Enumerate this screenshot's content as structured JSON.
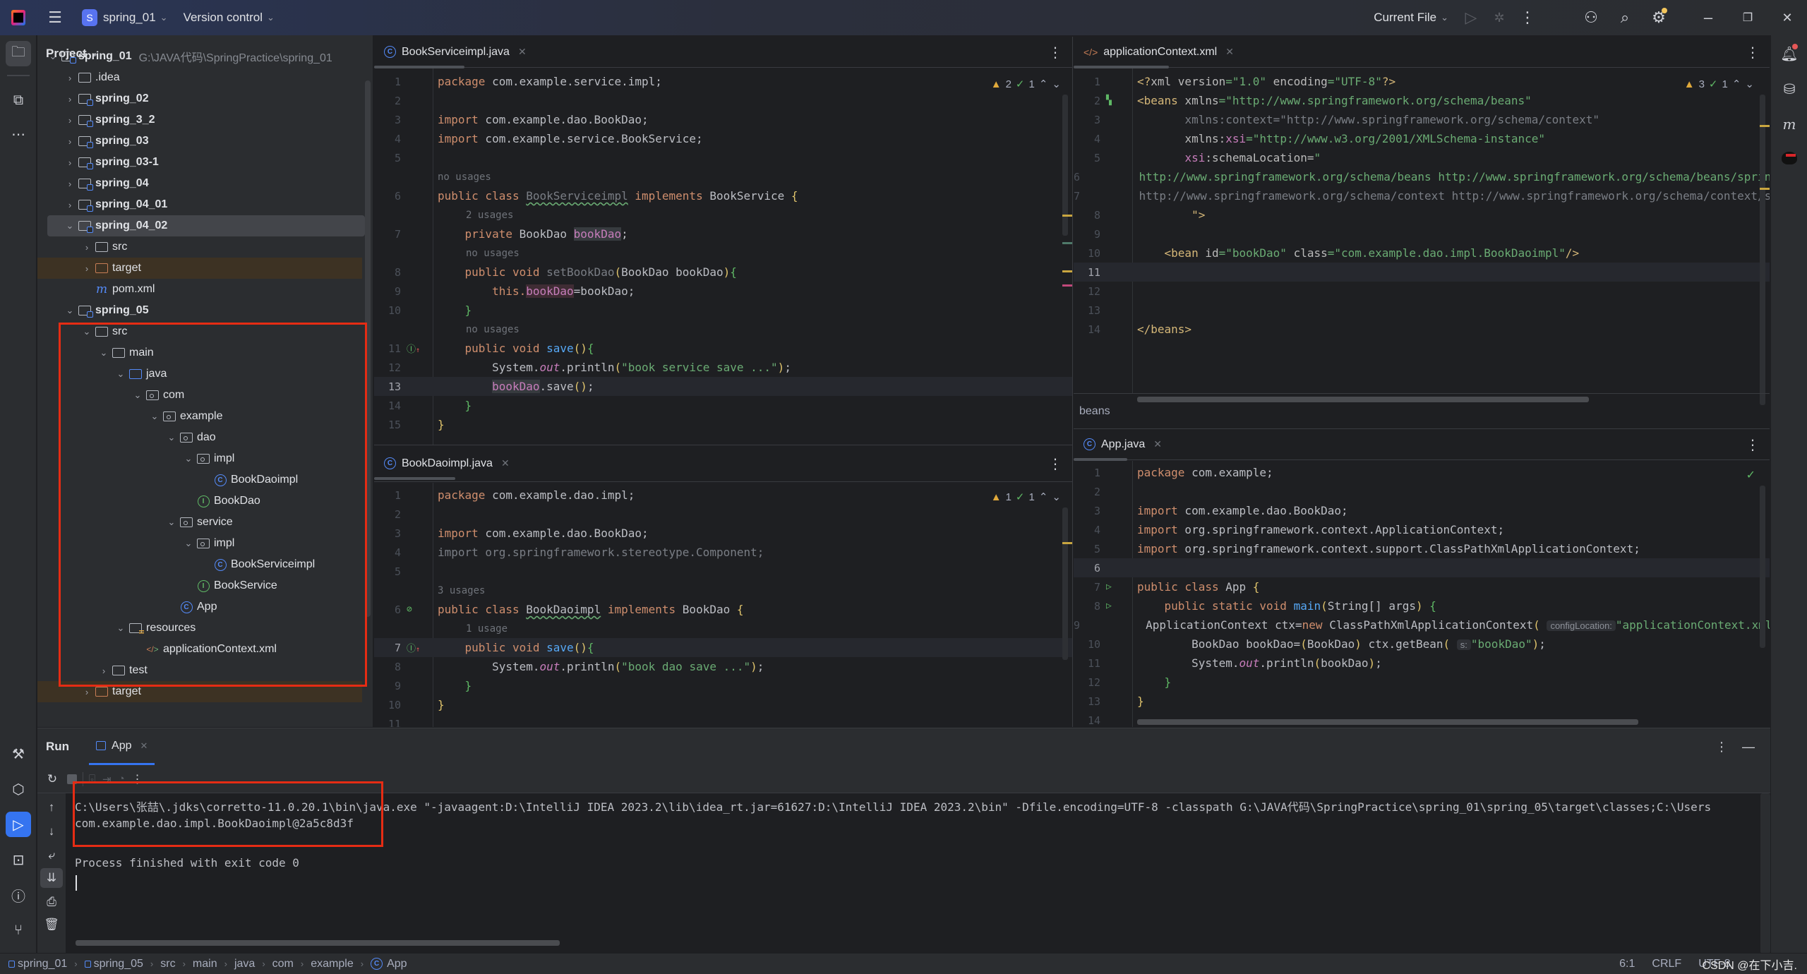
{
  "titlebar": {
    "project_badge": "S",
    "project_name": "spring_01",
    "vcs_label": "Version control",
    "run_config": "Current File",
    "icons": [
      "app-logo-icon",
      "hamburger-menu-icon",
      "run-icon",
      "debug-icon",
      "more-icon",
      "add-user-icon",
      "search-icon",
      "settings-icon",
      "minimize-icon",
      "restore-icon",
      "close-icon"
    ]
  },
  "project_panel": {
    "title": "Project",
    "tree": [
      {
        "label": "spring_01",
        "path": "G:\\JAVA代码\\SpringPractice\\spring_01",
        "icon": "module-folder-icon",
        "expanded": true,
        "depth": 0
      },
      {
        "label": ".idea",
        "icon": "folder-icon",
        "expanded": false,
        "depth": 1
      },
      {
        "label": "spring_02",
        "icon": "module-folder-icon",
        "expanded": false,
        "depth": 1
      },
      {
        "label": "spring_3_2",
        "icon": "module-folder-icon",
        "expanded": false,
        "depth": 1
      },
      {
        "label": "spring_03",
        "icon": "module-folder-icon",
        "expanded": false,
        "depth": 1
      },
      {
        "label": "spring_03-1",
        "icon": "module-folder-icon",
        "expanded": false,
        "depth": 1
      },
      {
        "label": "spring_04",
        "icon": "module-folder-icon",
        "expanded": false,
        "depth": 1
      },
      {
        "label": "spring_04_01",
        "icon": "module-folder-icon",
        "expanded": false,
        "depth": 1
      },
      {
        "label": "spring_04_02",
        "icon": "module-folder-icon",
        "expanded": true,
        "depth": 1,
        "selected": true
      },
      {
        "label": "src",
        "icon": "folder-icon",
        "expanded": false,
        "depth": 2
      },
      {
        "label": "target",
        "icon": "excluded-folder-icon",
        "expanded": false,
        "depth": 2
      },
      {
        "label": "pom.xml",
        "icon": "maven-icon",
        "depth": 2
      },
      {
        "label": "spring_05",
        "icon": "module-folder-icon",
        "expanded": true,
        "depth": 1
      },
      {
        "label": "src",
        "icon": "folder-icon",
        "expanded": true,
        "depth": 2
      },
      {
        "label": "main",
        "icon": "folder-icon",
        "expanded": true,
        "depth": 3
      },
      {
        "label": "java",
        "icon": "source-folder-icon",
        "expanded": true,
        "depth": 4
      },
      {
        "label": "com",
        "icon": "package-icon",
        "expanded": true,
        "depth": 5
      },
      {
        "label": "example",
        "icon": "package-icon",
        "expanded": true,
        "depth": 6
      },
      {
        "label": "dao",
        "icon": "package-icon",
        "expanded": true,
        "depth": 7
      },
      {
        "label": "impl",
        "icon": "package-icon",
        "expanded": true,
        "depth": 8
      },
      {
        "label": "BookDaoimpl",
        "icon": "class-icon",
        "depth": 9
      },
      {
        "label": "BookDao",
        "icon": "interface-icon",
        "depth": 8
      },
      {
        "label": "service",
        "icon": "package-icon",
        "expanded": true,
        "depth": 7
      },
      {
        "label": "impl",
        "icon": "package-icon",
        "expanded": true,
        "depth": 8
      },
      {
        "label": "BookServiceimpl",
        "icon": "class-icon",
        "depth": 9
      },
      {
        "label": "BookService",
        "icon": "interface-icon",
        "depth": 8
      },
      {
        "label": "App",
        "icon": "class-icon",
        "depth": 7
      },
      {
        "label": "resources",
        "icon": "resources-folder-icon",
        "expanded": true,
        "depth": 4
      },
      {
        "label": "applicationContext.xml",
        "icon": "spring-xml-icon",
        "depth": 5
      },
      {
        "label": "test",
        "icon": "folder-icon",
        "expanded": false,
        "depth": 3
      },
      {
        "label": "target",
        "icon": "excluded-folder-icon",
        "expanded": false,
        "depth": 2
      }
    ]
  },
  "editors": {
    "book_service_impl": {
      "tab": "BookServiceimpl.java",
      "warnings": "2",
      "ok": "1",
      "hints": {
        "h6": "no usages",
        "h7": "2 usages",
        "h8": "no usages",
        "h11": "no usages"
      },
      "current_line": 13
    },
    "book_dao_impl": {
      "tab": "BookDaoimpl.java",
      "warnings": "1",
      "ok": "1",
      "hints": {
        "h6": "3 usages",
        "h7": "1 usage"
      },
      "current_line": 7
    },
    "app_context_xml": {
      "tab": "applicationContext.xml",
      "warnings": "3",
      "ok": "1",
      "breadcrumb": "beans",
      "current_line": 11
    },
    "app_java": {
      "tab": "App.java",
      "inlay_config": "configLocation:",
      "inlay_s": "s:",
      "current_line": 6
    }
  },
  "code": {
    "bsi": {
      "l1a": "package",
      "l1b": " com.example.service.impl;",
      "l3a": "import",
      "l3b": " com.example.dao.BookDao;",
      "l4a": "import",
      "l4b": " com.example.service.BookService;",
      "l6a": "public class ",
      "l6b": "BookServiceimpl",
      "l6c": " implements ",
      "l6d": "BookService ",
      "l6e": "{",
      "l7a": "private ",
      "l7b": "BookDao ",
      "l7c": "bookDao",
      "l7d": ";",
      "l8a": "public void ",
      "l8b": "setBookDao",
      "l8c": "(",
      "l8d": "BookDao bookDao",
      "l8e": ")",
      "l8f": "{",
      "l9a": "this.",
      "l9b": "bookDao",
      "l9c": "=bookDao;",
      "l10": "}",
      "l11a": "public void ",
      "l11b": "save",
      "l11c": "()",
      "l11d": "{",
      "l12a": "System.",
      "l12b": "out",
      "l12c": ".println",
      "l12d": "(",
      "l12e": "\"book service save ...\"",
      "l12f": ")",
      "l12g": ";",
      "l13a": "bookDao",
      "l13b": ".save",
      "l13c": "()",
      "l13d": ";",
      "l14": "}",
      "l15": "}"
    },
    "bdi": {
      "l1a": "package",
      "l1b": " com.example.dao.impl;",
      "l3a": "import",
      "l3b": " com.example.dao.BookDao;",
      "l4": "import org.springframework.stereotype.Component;",
      "l6a": "public class ",
      "l6b": "BookDaoimpl",
      "l6c": " implements ",
      "l6d": "BookDao ",
      "l6e": "{",
      "l7a": "public void ",
      "l7b": "save",
      "l7c": "()",
      "l7d": "{",
      "l8a": "System.",
      "l8b": "out",
      "l8c": ".println",
      "l8d": "(",
      "l8e": "\"book dao save ...\"",
      "l8f": ")",
      "l8g": ";",
      "l9": "}",
      "l10": "}"
    },
    "xml": {
      "l1a": "<?",
      "l1b": "xml version",
      "l1c": "=",
      "l1d": "\"1.0\"",
      "l1e": " encoding",
      "l1f": "=",
      "l1g": "\"UTF-8\"",
      "l1h": "?>",
      "l2a": "<beans ",
      "l2b": "xmlns",
      "l2c": "=",
      "l2d": "\"http://www.springframework.org/schema/beans\"",
      "l3": "xmlns:context=\"http://www.springframework.org/schema/context\"",
      "l4a": "xmlns:",
      "l4b": "xsi",
      "l4c": "=",
      "l4d": "\"http://www.w3.org/2001/XMLSchema-instance\"",
      "l5a": "xsi",
      "l5b": ":schemaLocation=",
      "l5c": "\"",
      "l6": "http://www.springframework.org/schema/beans http://www.springframework.org/schema/beans/spring-beans.xsd",
      "l7": "http://www.springframework.org/schema/context http://www.springframework.org/schema/context/spring-context.xsd",
      "l8": "\">",
      "l10a": "<bean ",
      "l10b": "id",
      "l10c": "=",
      "l10d": "\"bookDao\"",
      "l10e": " class",
      "l10f": "=",
      "l10g": "\"com.example.dao.impl.BookDaoimpl\"",
      "l10h": "/>",
      "l14": "</beans>"
    },
    "app": {
      "l1a": "package",
      "l1b": " com.example;",
      "l3a": "import",
      "l3b": " com.example.dao.BookDao;",
      "l4a": "import",
      "l4b": " org.springframework.context.ApplicationContext;",
      "l5a": "import",
      "l5b": " org.springframework.context.support.ClassPathXmlApplicationContext;",
      "l7a": "public class ",
      "l7b": "App ",
      "l7c": "{",
      "l8a": "public static void ",
      "l8b": "main",
      "l8c": "(",
      "l8d": "String[] args",
      "l8e": ") ",
      "l8f": "{",
      "l9a": "ApplicationContext ctx=",
      "l9b": "new ",
      "l9c": "ClassPathXmlApplicationContext",
      "l9d": "(",
      "l9e": "\"applicationContext.xml\"",
      "l10a": "BookDao bookDao=",
      "l10b": "(",
      "l10c": "BookDao",
      "l10d": ")",
      "l10e": " ctx.getBean",
      "l10f": "(",
      "l10g": "\"bookDao\"",
      "l10h": ")",
      "l10i": ";",
      "l11a": "System.",
      "l11b": "out",
      "l11c": ".println",
      "l11d": "(",
      "l11e": "bookDao",
      "l11f": ")",
      "l11g": ";",
      "l12": "}",
      "l13": "}"
    }
  },
  "run_panel": {
    "title": "Run",
    "tab": "App",
    "console": {
      "cmd": "C:\\Users\\张喆\\.jdks\\corretto-11.0.20.1\\bin\\java.exe \"-javaagent:D:\\IntelliJ IDEA 2023.2\\lib\\idea_rt.jar=61627:D:\\IntelliJ IDEA 2023.2\\bin\" -Dfile.encoding=UTF-8 -classpath G:\\JAVA代码\\SpringPractice\\spring_01\\spring_05\\target\\classes;C:\\Users",
      "output": "com.example.dao.impl.BookDaoimpl@2a5c8d3f",
      "exit": "Process finished with exit code 0"
    }
  },
  "statusbar": {
    "breadcrumbs": [
      "spring_01",
      "spring_05",
      "src",
      "main",
      "java",
      "com",
      "example",
      "App"
    ],
    "position": "6:1",
    "line_sep": "CRLF",
    "encoding": "UTF-8",
    "watermark": "CSDN @在下小吉."
  }
}
